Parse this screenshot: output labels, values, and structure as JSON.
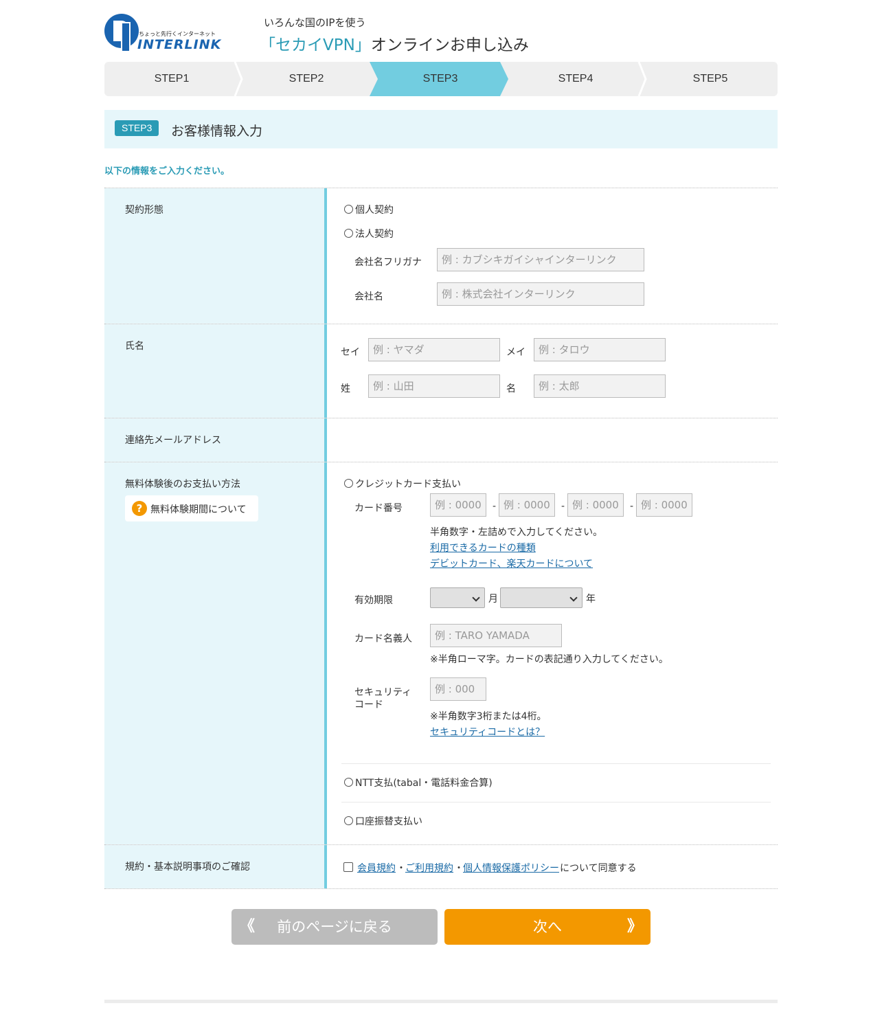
{
  "header": {
    "logo_tagline": "ちょっと先行くインターネット",
    "logo_word": "INTERLINK",
    "subtitle": "いろんな国のIPを使う",
    "title_accent": "「セカイVPN」",
    "title_rest": "オンラインお申し込み"
  },
  "steps": [
    {
      "label": "STEP1",
      "active": false
    },
    {
      "label": "STEP2",
      "active": false
    },
    {
      "label": "STEP3",
      "active": true
    },
    {
      "label": "STEP4",
      "active": false
    },
    {
      "label": "STEP5",
      "active": false
    }
  ],
  "section": {
    "badge": "STEP3",
    "title": "お客様情報入力",
    "intro": "以下の情報をご入力ください。"
  },
  "contract": {
    "label": "契約形態",
    "personal": "個人契約",
    "corporate": "法人契約",
    "company_kana_label": "会社名フリガナ",
    "company_kana_placeholder": "例 : カブシキガイシャインターリンク",
    "company_label": "会社名",
    "company_placeholder": "例 : 株式会社インターリンク"
  },
  "name": {
    "label": "氏名",
    "sei_kana_label": "セイ",
    "sei_kana_placeholder": "例 : ヤマダ",
    "mei_kana_label": "メイ",
    "mei_kana_placeholder": "例 : タロウ",
    "sei_label": "姓",
    "sei_placeholder": "例 : 山田",
    "mei_label": "名",
    "mei_placeholder": "例 : 太郎"
  },
  "email": {
    "label": "連絡先メールアドレス"
  },
  "payment": {
    "label": "無料体験後のお支払い方法",
    "help": "無料体験期間について",
    "credit": "クレジットカード支払い",
    "card_number_label": "カード番号",
    "card_placeholder": "例 : 0000",
    "sep": "-",
    "card_note": "半角数字・左詰めで入力してください。",
    "card_types_link": "利用できるカードの種類",
    "debit_link": "デビットカード、楽天カードについて",
    "expiry_label": "有効期限",
    "month_unit": "月",
    "year_unit": "年",
    "holder_label": "カード名義人",
    "holder_placeholder": "例 : TARO YAMADA",
    "holder_note": "※半角ローマ字。カードの表記通り入力してください。",
    "security_label_1": "セキュリティ",
    "security_label_2": "コード",
    "security_placeholder": "例 : 000",
    "security_note": "※半角数字3桁または4桁。",
    "security_link": "セキュリティコードとは？",
    "ntt": "NTT支払(tabal・電話料金合算)",
    "bank": "口座振替支払い"
  },
  "terms": {
    "label": "規約・基本説明事項のご確認",
    "member_link": "会員規約",
    "dot": "・",
    "usage_link": "ご利用規約",
    "privacy_link": "個人情報保護ポリシー",
    "agree": "について同意する"
  },
  "buttons": {
    "back": "前のページに戻る",
    "next": "次へ",
    "back_arrow": "《",
    "next_arrow": "》"
  },
  "colors": {
    "accent": "#2a9bb5",
    "step_active": "#72cde0",
    "label_bg": "#e6f6fa",
    "next": "#f39800",
    "back": "#bcbcbc"
  }
}
